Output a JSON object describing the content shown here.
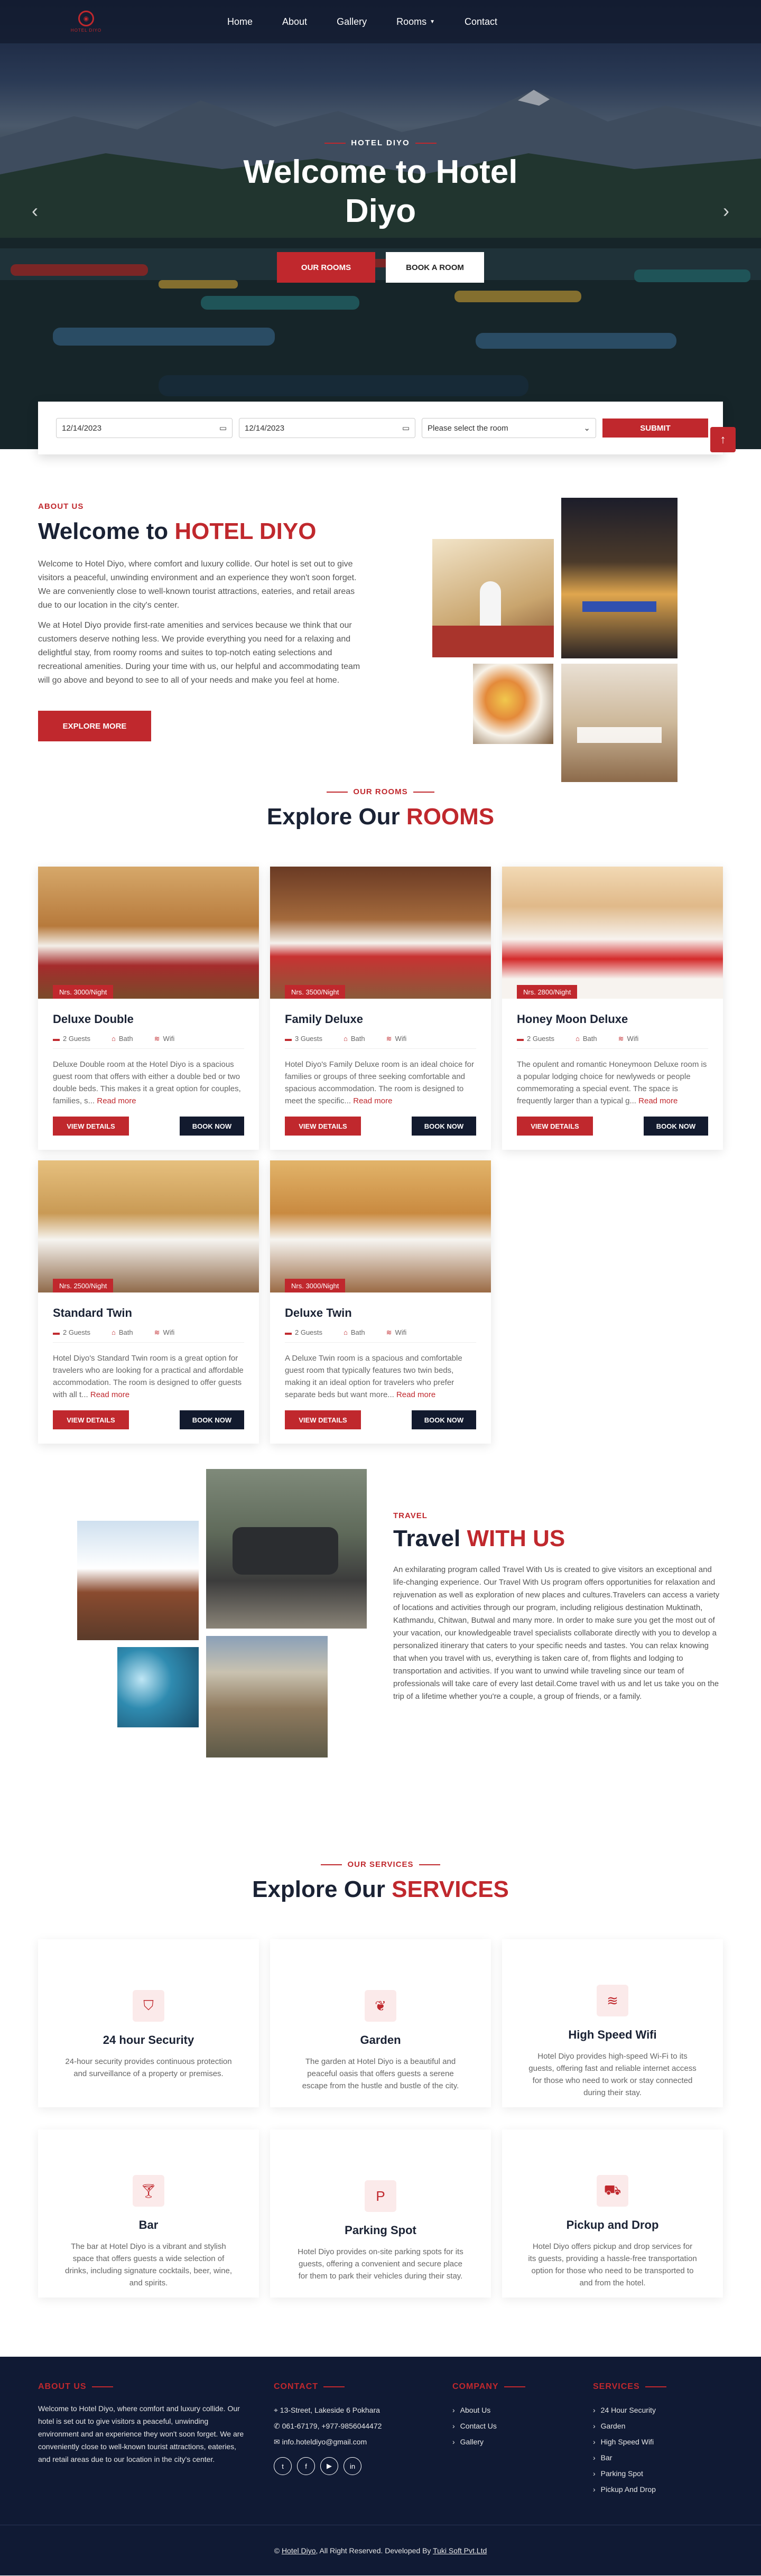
{
  "brand": {
    "logo_text": "HOTEL DIYO",
    "accent": "#c0282d",
    "navy": "#121a2e"
  },
  "nav": {
    "items": [
      "Home",
      "About",
      "Gallery",
      "Rooms",
      "Contact"
    ]
  },
  "hero": {
    "eyebrow": "HOTEL DIYO",
    "title": "Welcome to Hotel Diyo",
    "btn_rooms": "OUR ROOMS",
    "btn_book": "BOOK A ROOM",
    "prev_icon": "chevron-left-icon",
    "next_icon": "chevron-right-icon"
  },
  "booking": {
    "checkin": "12/14/2023",
    "checkout": "12/14/2023",
    "room_select": "Please select the room",
    "submit": "SUBMIT"
  },
  "about": {
    "eyebrow": "ABOUT US",
    "title_plain": "Welcome to ",
    "title_accent": "HOTEL DIYO",
    "p1": "Welcome to Hotel Diyo, where comfort and luxury collide. Our hotel is set out to give visitors a peaceful, unwinding environment and an experience they won't soon forget. We are conveniently close to well-known tourist attractions, eateries, and retail areas due to our location in the city's center.",
    "p2": "We at Hotel Diyo provide first-rate amenities and services because we think that our customers deserve nothing less. We provide everything you need for a relaxing and delightful stay, from roomy rooms and suites to top-notch eating selections and recreational amenities. During your time with us, our helpful and accommodating team will go above and beyond to see to all of your needs and make you feel at home.",
    "btn": "EXPLORE MORE"
  },
  "rooms": {
    "eyebrow": "OUR ROOMS",
    "title_plain": "Explore Our ",
    "title_accent": "ROOMS",
    "view_label": "VIEW DETAILS",
    "book_label": "BOOK NOW",
    "read_more": "Read more",
    "bath": "Bath",
    "wifi": "Wifi",
    "items": [
      {
        "name": "Deluxe Double",
        "price": "Nrs. 3000/Night",
        "guests": "2 Guests",
        "desc": "Deluxe Double room at the Hotel Diyo is a spacious guest room that offers with either a double bed or two double beds. This makes it a great option for couples, families, s..."
      },
      {
        "name": "Family Deluxe",
        "price": "Nrs. 3500/Night",
        "guests": "3 Guests",
        "desc": "Hotel Diyo's Family Deluxe room is an ideal choice for families or groups of three seeking comfortable and spacious accommodation. The room is designed to meet the specific..."
      },
      {
        "name": "Honey Moon Deluxe",
        "price": "Nrs. 2800/Night",
        "guests": "2 Guests",
        "desc": "The opulent and romantic Honeymoon Deluxe room is a popular lodging choice for newlyweds or people commemorating a special event. The space is frequently larger than a typical g..."
      },
      {
        "name": "Standard Twin",
        "price": "Nrs. 2500/Night",
        "guests": "2 Guests",
        "desc": "Hotel Diyo's Standard Twin room is a great option for travelers who are looking for a practical and affordable accommodation. The room is designed to offer guests with all t..."
      },
      {
        "name": "Deluxe Twin",
        "price": "Nrs. 3000/Night",
        "guests": "2 Guests",
        "desc": "A Deluxe Twin room is a spacious and comfortable guest room that typically features two twin beds, making it an ideal option for travelers who prefer separate beds but want more..."
      }
    ]
  },
  "travel": {
    "eyebrow": "TRAVEL",
    "title_plain": "Travel ",
    "title_accent": "WITH US",
    "p": "An exhilarating program called Travel With Us is created to give visitors an exceptional and life-changing experience. Our Travel With Us program offers opportunities for relaxation and rejuvenation as well as exploration of new places and cultures.Travelers can access a variety of locations and activities through our program, including religious destination Muktinath, Kathmandu, Chitwan, Butwal and many more. In order to make sure you get the most out of your vacation, our knowledgeable travel specialists collaborate directly with you to develop a personalized itinerary that caters to your specific needs and tastes. You can relax knowing that when you travel with us, everything is taken care of, from flights and lodging to transportation and activities. If you want to unwind while traveling since our team of professionals will take care of every last detail.Come travel with us and let us take you on the trip of a lifetime whether you're a couple, a group of friends, or a family."
  },
  "services": {
    "eyebrow": "OUR SERVICES",
    "title_plain": "Explore Our ",
    "title_accent": "SERVICES",
    "items": [
      {
        "title": "24 hour Security",
        "icon": "shield-icon",
        "desc": "24-hour security provides continuous protection and surveillance of a property or premises."
      },
      {
        "title": "Garden",
        "icon": "plant-icon",
        "desc": "The garden at Hotel Diyo is a beautiful and peaceful oasis that offers guests a serene escape from the hustle and bustle of the city."
      },
      {
        "title": "High Speed Wifi",
        "icon": "wifi-icon",
        "desc": "Hotel Diyo provides high-speed Wi-Fi to its guests, offering fast and reliable internet access for those who need to work or stay connected during their stay."
      },
      {
        "title": "Bar",
        "icon": "cocktail-icon",
        "desc": "The bar at Hotel Diyo is a vibrant and stylish space that offers guests a wide selection of drinks, including signature cocktails, beer, wine, and spirits."
      },
      {
        "title": "Parking Spot",
        "icon": "parking-icon",
        "desc": "Hotel Diyo provides on-site parking spots for its guests, offering a convenient and secure place for them to park their vehicles during their stay."
      },
      {
        "title": "Pickup and Drop",
        "icon": "car-icon",
        "desc": "Hotel Diyo offers pickup and drop services for its guests, providing a hassle-free transportation option for those who need to be transported to and from the hotel."
      }
    ]
  },
  "footer": {
    "about_head": "ABOUT US",
    "about_text": "Welcome to Hotel Diyo, where comfort and luxury collide. Our hotel is set out to give visitors a peaceful, unwinding environment and an experience they won't soon forget. We are conveniently close to well-known tourist attractions, eateries, and retail areas due to our location in the city's center.",
    "contact_head": "CONTACT",
    "address": "13-Street, Lakeside 6 Pokhara",
    "phone": "061-67179, +977-9856044472",
    "email": "info.hoteldiyo@gmail.com",
    "company_head": "COMPANY",
    "company_links": [
      "About Us",
      "Contact Us",
      "Gallery"
    ],
    "services_head": "SERVICES",
    "service_links": [
      "24 Hour Security",
      "Garden",
      "High Speed Wifi",
      "Bar",
      "Parking Spot",
      "Pickup And Drop"
    ],
    "copyright_prefix": "© ",
    "copyright_brand": "Hotel Diyo",
    "copyright_mid": ", All Right Reserved. Developed By ",
    "copyright_dev": "Tuki Soft Pvt.Ltd"
  }
}
